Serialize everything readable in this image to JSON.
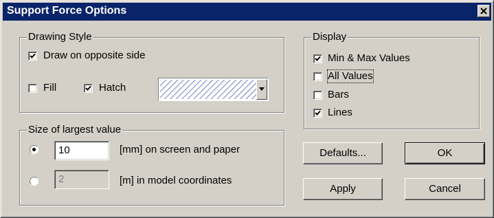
{
  "window": {
    "title": "Support Force Options"
  },
  "drawing_style": {
    "legend": "Drawing Style",
    "draw_opposite": {
      "label": "Draw on opposite side",
      "checked": true
    },
    "fill": {
      "label": "Fill",
      "checked": false
    },
    "hatch": {
      "label": "Hatch",
      "checked": true
    },
    "hatch_pattern": {
      "color": "#1a1aa0"
    }
  },
  "display": {
    "legend": "Display",
    "min_max": {
      "label": "Min & Max Values",
      "checked": true
    },
    "all_values": {
      "label": "All Values",
      "checked": false
    },
    "bars": {
      "label": "Bars",
      "checked": false
    },
    "lines": {
      "label": "Lines",
      "checked": true
    }
  },
  "size": {
    "legend": "Size of largest value",
    "screen": {
      "value": "10",
      "label": "[mm] on screen and paper",
      "selected": true
    },
    "model": {
      "value": "2",
      "label": "[m] in model coordinates",
      "selected": false
    }
  },
  "buttons": {
    "defaults": "Defaults...",
    "ok": "OK",
    "apply": "Apply",
    "cancel": "Cancel"
  },
  "colors": {
    "titlebar": "#0a246a",
    "face": "#d4d0c8"
  }
}
